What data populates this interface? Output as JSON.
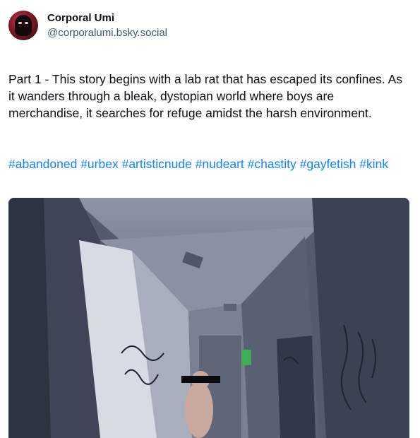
{
  "author": {
    "display_name": "Corporal Umi",
    "handle": "@corporalumi.bsky.social",
    "avatar_icon": "masked-avatar-icon"
  },
  "post": {
    "text": "Part 1 - This story begins with a lab rat that has escaped its confines. As it wanders through a bleak, dystopian world where boys are merchandise, it searches for refuge amidst the harsh environment.",
    "hashtags": [
      "#abandoned",
      "#urbex",
      "#artisticnude",
      "#nudeart",
      "#chastity",
      "#gayfetish",
      "#kink"
    ]
  },
  "colors": {
    "link": "#1083fe",
    "handle": "#42576c",
    "text": "#0b0f14"
  }
}
